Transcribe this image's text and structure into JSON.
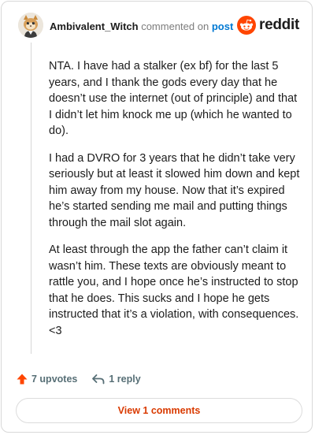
{
  "header": {
    "username": "Ambivalent_Witch",
    "action_text": "commented on",
    "post_link": "post",
    "brand": "reddit"
  },
  "comment": {
    "paragraphs": [
      "NTA. I have had a stalker (ex bf) for the last 5 years, and I thank the gods every day that he doesn’t use the internet (out of principle) and that I didn’t let him knock me up (which he wanted to do).",
      "I had a DVRO for 3 years that he didn’t take very seriously but at least it slowed him down and kept him away from my house. Now that it’s expired he’s started sending me mail and putting things through the mail slot again.",
      "At least through the app the father can’t claim it wasn’t him. These texts are obviously meant to rattle you, and I hope once he’s instructed to stop that he does. This sucks and I hope he gets instructed that it’s a violation, with consequences. <3"
    ]
  },
  "actions": {
    "upvotes_label": "7 upvotes",
    "reply_label": "1 reply"
  },
  "footer": {
    "view_comments_label": "View 1 comments"
  },
  "colors": {
    "brand_orange": "#ff4500",
    "link_blue": "#0079d3",
    "button_text": "#d93a00",
    "muted_text": "#576f76"
  },
  "icons": {
    "avatar": "avatar",
    "brand_logo": "reddit-snoo-icon",
    "upvote": "upvote-arrow-icon",
    "reply": "reply-arrow-icon"
  }
}
